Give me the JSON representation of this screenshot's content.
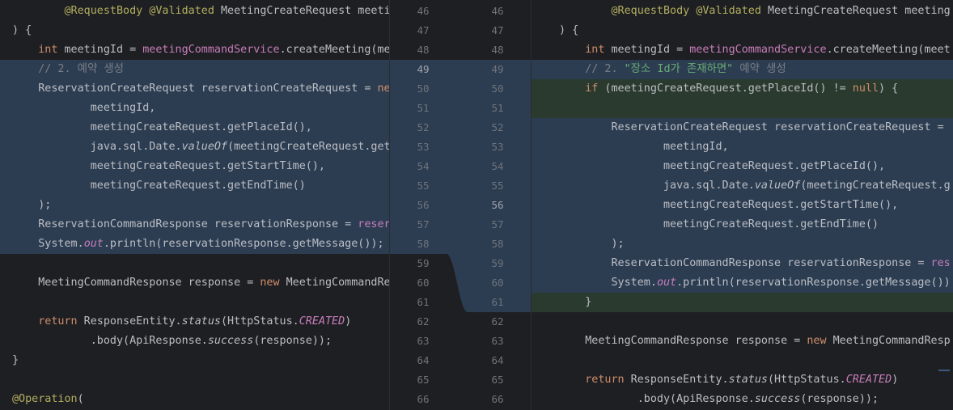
{
  "left_lines": [
    {
      "indent": "        ",
      "tokens": [
        [
          "ann",
          "@RequestBody"
        ],
        [
          "t",
          " "
        ],
        [
          "ann",
          "@Validated"
        ],
        [
          "t",
          " MeetingCreateRequest meeti"
        ]
      ],
      "hl": ""
    },
    {
      "indent": "",
      "tokens": [
        [
          "t",
          ") {"
        ]
      ],
      "hl": ""
    },
    {
      "indent": "    ",
      "tokens": [
        [
          "kw",
          "int"
        ],
        [
          "t",
          " meetingId = "
        ],
        [
          "fld",
          "meetingCommandService"
        ],
        [
          "t",
          ".createMeeting(me"
        ]
      ],
      "hl": ""
    },
    {
      "indent": "    ",
      "tokens": [
        [
          "cm",
          "// 2. 예약 생성"
        ]
      ],
      "hl": "mod"
    },
    {
      "indent": "    ",
      "tokens": [
        [
          "t",
          "ReservationCreateRequest reservationCreateRequest = "
        ],
        [
          "kw",
          "ne"
        ]
      ],
      "hl": "mod"
    },
    {
      "indent": "            ",
      "tokens": [
        [
          "t",
          "meetingId,"
        ]
      ],
      "hl": "mod"
    },
    {
      "indent": "            ",
      "tokens": [
        [
          "t",
          "meetingCreateRequest.getPlaceId(),"
        ]
      ],
      "hl": "mod"
    },
    {
      "indent": "            ",
      "tokens": [
        [
          "t",
          "java.sql.Date."
        ],
        [
          "it",
          "valueOf"
        ],
        [
          "t",
          "(meetingCreateRequest.get"
        ]
      ],
      "hl": "mod"
    },
    {
      "indent": "            ",
      "tokens": [
        [
          "t",
          "meetingCreateRequest.getStartTime(),"
        ]
      ],
      "hl": "mod"
    },
    {
      "indent": "            ",
      "tokens": [
        [
          "t",
          "meetingCreateRequest.getEndTime()"
        ]
      ],
      "hl": "mod"
    },
    {
      "indent": "    ",
      "tokens": [
        [
          "t",
          ");"
        ]
      ],
      "hl": "mod"
    },
    {
      "indent": "    ",
      "tokens": [
        [
          "t",
          "ReservationCommandResponse reservationResponse = "
        ],
        [
          "fld",
          "reser"
        ]
      ],
      "hl": "mod"
    },
    {
      "indent": "    ",
      "tokens": [
        [
          "t",
          "System."
        ],
        [
          "fldit",
          "out"
        ],
        [
          "t",
          ".println(reservationResponse.getMessage());"
        ]
      ],
      "hl": "mod"
    },
    {
      "indent": "",
      "tokens": [],
      "hl": ""
    },
    {
      "indent": "    ",
      "tokens": [
        [
          "t",
          "MeetingCommandResponse response = "
        ],
        [
          "kw",
          "new"
        ],
        [
          "t",
          " MeetingCommandRe"
        ]
      ],
      "hl": ""
    },
    {
      "indent": "",
      "tokens": [],
      "hl": ""
    },
    {
      "indent": "    ",
      "tokens": [
        [
          "kw",
          "return"
        ],
        [
          "t",
          " ResponseEntity."
        ],
        [
          "it",
          "status"
        ],
        [
          "t",
          "(HttpStatus."
        ],
        [
          "fldit",
          "CREATED"
        ],
        [
          "t",
          ")"
        ]
      ],
      "hl": ""
    },
    {
      "indent": "            ",
      "tokens": [
        [
          "t",
          ".body(ApiResponse."
        ],
        [
          "it",
          "success"
        ],
        [
          "t",
          "(response));"
        ]
      ],
      "hl": ""
    },
    {
      "indent": "",
      "tokens": [
        [
          "t",
          "}"
        ]
      ],
      "hl": ""
    },
    {
      "indent": "",
      "tokens": [],
      "hl": ""
    },
    {
      "indent": "",
      "tokens": [
        [
          "ann",
          "@Operation"
        ],
        [
          "t",
          "("
        ]
      ],
      "hl": ""
    }
  ],
  "right_lines": [
    {
      "indent": "        ",
      "tokens": [
        [
          "ann",
          "@RequestBody"
        ],
        [
          "t",
          " "
        ],
        [
          "ann",
          "@Validated"
        ],
        [
          "t",
          " MeetingCreateRequest meeting"
        ]
      ],
      "hl": ""
    },
    {
      "indent": "",
      "tokens": [
        [
          "t",
          ") {"
        ]
      ],
      "hl": ""
    },
    {
      "indent": "    ",
      "tokens": [
        [
          "kw",
          "int"
        ],
        [
          "t",
          " meetingId = "
        ],
        [
          "fld",
          "meetingCommandService"
        ],
        [
          "t",
          ".createMeeting(meet"
        ]
      ],
      "hl": ""
    },
    {
      "indent": "    ",
      "tokens": [
        [
          "cm",
          "// 2. "
        ],
        [
          "str",
          "\"장소 Id가 존재하면\""
        ],
        [
          "cm",
          " 예약 생성"
        ]
      ],
      "hl": "mod"
    },
    {
      "indent": "    ",
      "tokens": [
        [
          "kw",
          "if"
        ],
        [
          "t",
          " (meetingCreateRequest.getPlaceId() != "
        ],
        [
          "kw",
          "null"
        ],
        [
          "t",
          ") {"
        ]
      ],
      "hl": "add"
    },
    {
      "indent": "",
      "tokens": [],
      "hl": "add"
    },
    {
      "indent": "        ",
      "tokens": [
        [
          "t",
          "ReservationCreateRequest reservationCreateRequest ="
        ]
      ],
      "hl": "mod"
    },
    {
      "indent": "                ",
      "tokens": [
        [
          "t",
          "meetingId,"
        ]
      ],
      "hl": "mod"
    },
    {
      "indent": "                ",
      "tokens": [
        [
          "t",
          "meetingCreateRequest.getPlaceId(),"
        ]
      ],
      "hl": "mod"
    },
    {
      "indent": "                ",
      "tokens": [
        [
          "t",
          "java.sql.Date."
        ],
        [
          "it",
          "valueOf"
        ],
        [
          "t",
          "(meetingCreateRequest.g"
        ]
      ],
      "hl": "mod"
    },
    {
      "indent": "                ",
      "tokens": [
        [
          "t",
          "meetingCreateRequest.getStartTime(),"
        ]
      ],
      "hl": "mod"
    },
    {
      "indent": "                ",
      "tokens": [
        [
          "t",
          "meetingCreateRequest.getEndTime()"
        ]
      ],
      "hl": "mod"
    },
    {
      "indent": "        ",
      "tokens": [
        [
          "t",
          ");"
        ]
      ],
      "hl": "mod"
    },
    {
      "indent": "        ",
      "tokens": [
        [
          "t",
          "ReservationCommandResponse reservationResponse = "
        ],
        [
          "fld",
          "res"
        ]
      ],
      "hl": "mod"
    },
    {
      "indent": "        ",
      "tokens": [
        [
          "t",
          "System."
        ],
        [
          "fldit",
          "out"
        ],
        [
          "t",
          ".println(reservationResponse.getMessage())"
        ]
      ],
      "hl": "mod"
    },
    {
      "indent": "    ",
      "tokens": [
        [
          "t",
          "}"
        ]
      ],
      "hl": "add"
    },
    {
      "indent": "",
      "tokens": [],
      "hl": ""
    },
    {
      "indent": "    ",
      "tokens": [
        [
          "t",
          "MeetingCommandResponse response = "
        ],
        [
          "kw",
          "new"
        ],
        [
          "t",
          " MeetingCommandResp"
        ]
      ],
      "hl": ""
    },
    {
      "indent": "",
      "tokens": [],
      "hl": ""
    },
    {
      "indent": "    ",
      "tokens": [
        [
          "kw",
          "return"
        ],
        [
          "t",
          " ResponseEntity."
        ],
        [
          "it",
          "status"
        ],
        [
          "t",
          "(HttpStatus."
        ],
        [
          "fldit",
          "CREATED"
        ],
        [
          "t",
          ")"
        ]
      ],
      "hl": ""
    },
    {
      "indent": "            ",
      "tokens": [
        [
          "t",
          ".body(ApiResponse."
        ],
        [
          "it",
          "success"
        ],
        [
          "t",
          "(response));"
        ]
      ],
      "hl": ""
    }
  ],
  "left_numbers": [
    "46",
    "47",
    "48",
    "49",
    "50",
    "51",
    "52",
    "53",
    "54",
    "55",
    "56",
    "57",
    "58",
    "59",
    "60",
    "61",
    "62",
    "63",
    "64",
    "65",
    "66"
  ],
  "right_numbers": [
    "46",
    "47",
    "48",
    "49",
    "50",
    "51",
    "52",
    "53",
    "54",
    "55",
    "56",
    "57",
    "58",
    "59",
    "60",
    "61",
    "62",
    "63",
    "64",
    "65",
    "66"
  ],
  "current_left_number": "49",
  "current_right_number": "56"
}
